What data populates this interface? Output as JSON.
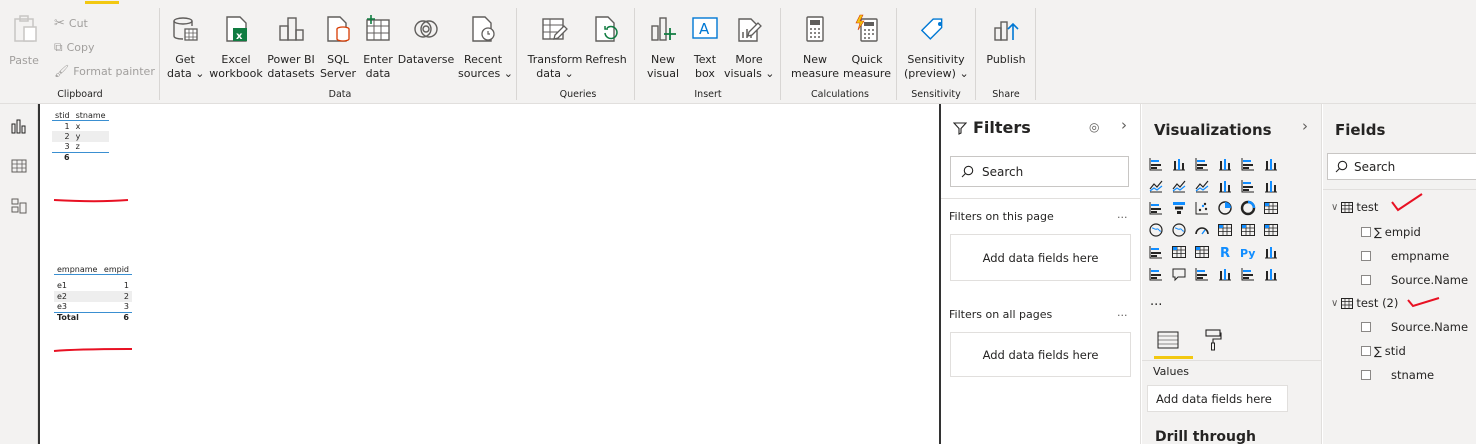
{
  "ribbon": {
    "clipboard": {
      "label": "Clipboard",
      "paste": "Paste",
      "cut": "Cut",
      "copy": "Copy",
      "format_painter": "Format painter"
    },
    "data": {
      "label": "Data",
      "get_data": [
        "Get",
        "data"
      ],
      "excel": [
        "Excel",
        "workbook"
      ],
      "pbi": [
        "Power BI",
        "datasets"
      ],
      "sql": [
        "SQL",
        "Server"
      ],
      "enter": [
        "Enter",
        "data"
      ],
      "dataverse": "Dataverse",
      "recent": [
        "Recent",
        "sources"
      ]
    },
    "queries": {
      "label": "Queries",
      "transform": [
        "Transform",
        "data"
      ],
      "refresh": "Refresh"
    },
    "insert": {
      "label": "Insert",
      "new_visual": [
        "New",
        "visual"
      ],
      "text_box": [
        "Text",
        "box"
      ],
      "more_visuals": [
        "More",
        "visuals"
      ]
    },
    "calculations": {
      "label": "Calculations",
      "new_measure": [
        "New",
        "measure"
      ],
      "quick_measure": [
        "Quick",
        "measure"
      ]
    },
    "sensitivity": {
      "label": "Sensitivity",
      "btn": [
        "Sensitivity",
        "(preview)"
      ]
    },
    "share": {
      "label": "Share",
      "publish": "Publish"
    }
  },
  "table1": {
    "headers": [
      "stid",
      "stname"
    ],
    "rows": [
      [
        "1",
        "x"
      ],
      [
        "2",
        "y"
      ],
      [
        "3",
        "z"
      ]
    ],
    "total": "6"
  },
  "table2": {
    "headers": [
      "empname",
      "empid"
    ],
    "rows": [
      [
        "e1",
        "1"
      ],
      [
        "e2",
        "2"
      ],
      [
        "e3",
        "3"
      ]
    ],
    "total_label": "Total",
    "total": "6"
  },
  "filters": {
    "title": "Filters",
    "search_placeholder": "Search",
    "on_page": "Filters on this page",
    "on_all": "Filters on all pages",
    "add_fields": "Add data fields here",
    "more": "..."
  },
  "visualizations": {
    "title": "Visualizations",
    "values_label": "Values",
    "add_fields": "Add data fields here",
    "drill_through": "Drill through",
    "more": "...",
    "r_label": "R",
    "py_label": "Py"
  },
  "fields": {
    "title": "Fields",
    "search_placeholder": "Search",
    "tables": [
      {
        "name": "test",
        "fields": [
          "empid",
          "empname",
          "Source.Name"
        ]
      },
      {
        "name": "test (2)",
        "fields": [
          "Source.Name",
          "stid",
          "stname"
        ]
      }
    ],
    "sigma": "∑"
  },
  "colors": {
    "accent": "#f2c811",
    "annotation": "#e81123"
  }
}
